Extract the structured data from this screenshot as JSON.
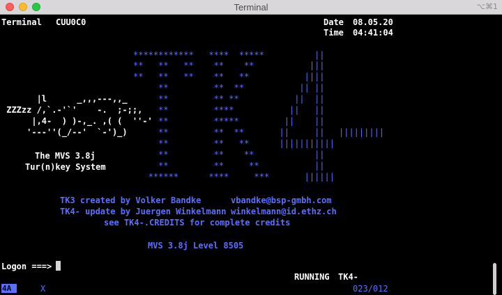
{
  "window": {
    "title": "Terminal",
    "shortcut": "⌥⌘1"
  },
  "header": {
    "terminal_label": "Terminal",
    "terminal_id": "CUU0C0",
    "date_label": "Date",
    "date_value": "08.05.20",
    "time_label": "Time",
    "time_value": "04:41:04"
  },
  "logo_tk": [
    "************   ****  *****          ||",
    "**   **   **    **    **           |||",
    "**   **   **    **   **           ||||",
    "     **         **  **           || ||",
    "     **         ** **           ||  ||",
    "     **         ****           ||   ||",
    "     **         *****         ||    ||",
    "     **         **  **       ||     ||",
    "     **         **   **      |||||||||||",
    "     **         **    **            ||",
    "     **         **     **           ||",
    "   ******      ****     ***       ||||||"
  ],
  "logo_bar": "|||||||||",
  "turnkey_art": [
    "       |l      _,,,---,,_",
    " ZZZzz /,`.-'`'    -.  ;-;;,",
    "      |,4-  ) )-,_. ,( (  ''-'",
    "     '---''(_/--'  `-')_)"
  ],
  "system": {
    "line1": "The MVS 3.8j",
    "line2": "Tur(n)key System"
  },
  "credits": [
    {
      "text": "TK3 created by Volker Bandke",
      "email": "vbandke@bsp-gmbh.com"
    },
    {
      "text": "TK4- update by Juergen Winkelmann",
      "email": "winkelmann@id.ethz.ch"
    }
  ],
  "credits_note": "see TK4-.CREDITS for complete credits",
  "level": "MVS 3.8j Level 8505",
  "logon": {
    "prompt": "Logon ===>",
    "value": ""
  },
  "status": {
    "running": "RUNNING",
    "system": "TK4-",
    "oia_indicator": "4A",
    "oia_x": "X",
    "cursor_pos": "023/012"
  },
  "colors": {
    "background": "#000000",
    "text": "#ffffff",
    "accent_blue": "#5a6fff"
  }
}
